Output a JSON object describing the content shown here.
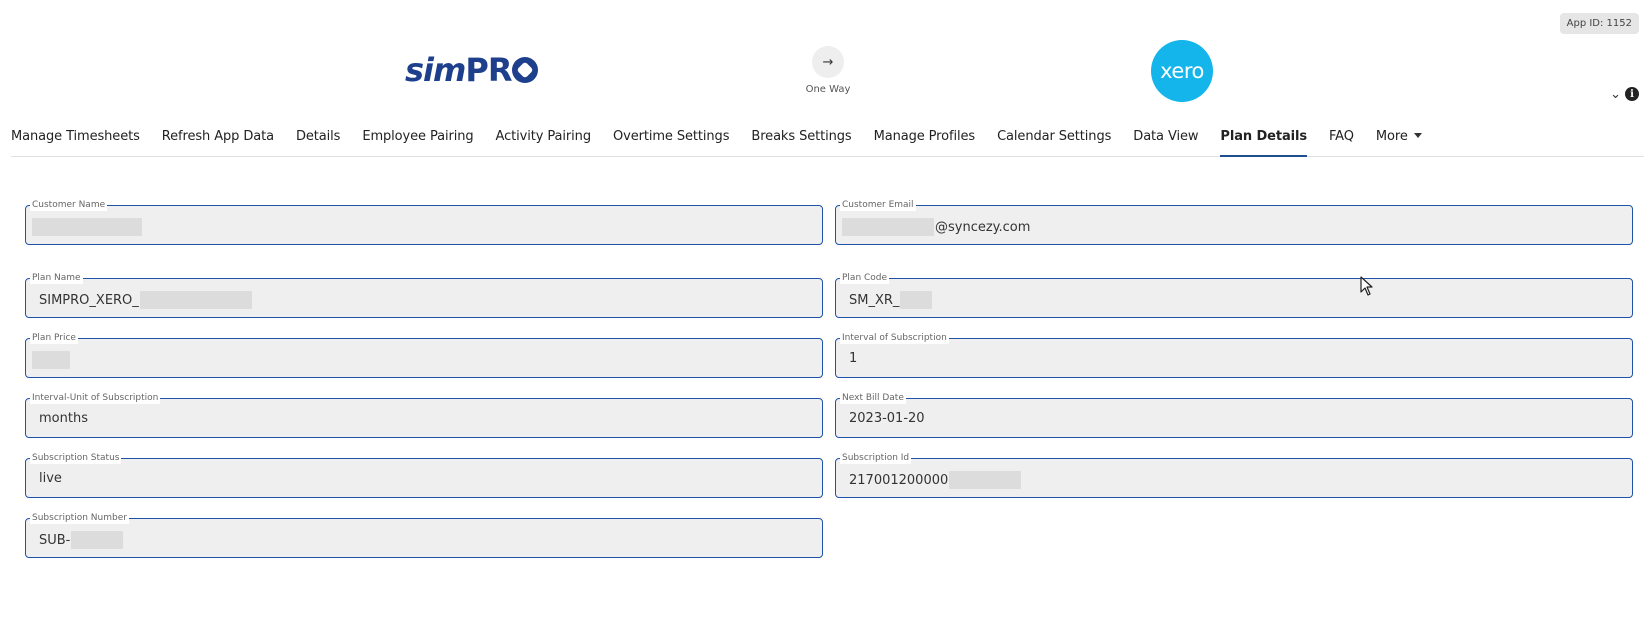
{
  "app_id": "App ID: 1152",
  "header": {
    "left_logo": {
      "part1": "sim",
      "part2": "PR"
    },
    "sync": {
      "icon": "arrow-right-icon",
      "glyph": "→",
      "label": "One Way"
    },
    "right_logo": "xero",
    "collapse_glyph": "⌄",
    "info_glyph": "i"
  },
  "nav": {
    "tabs": [
      {
        "label": "Manage Timesheets",
        "active": false
      },
      {
        "label": "Refresh App Data",
        "active": false
      },
      {
        "label": "Details",
        "active": false
      },
      {
        "label": "Employee Pairing",
        "active": false
      },
      {
        "label": "Activity Pairing",
        "active": false
      },
      {
        "label": "Overtime Settings",
        "active": false
      },
      {
        "label": "Breaks Settings",
        "active": false
      },
      {
        "label": "Manage Profiles",
        "active": false
      },
      {
        "label": "Calendar Settings",
        "active": false
      },
      {
        "label": "Data View",
        "active": false
      },
      {
        "label": "Plan Details",
        "active": true
      },
      {
        "label": "FAQ",
        "active": false
      },
      {
        "label": "More",
        "active": false
      }
    ]
  },
  "fields": {
    "customer_name": {
      "label": "Customer Name",
      "value": ""
    },
    "customer_email": {
      "label": "Customer Email",
      "value": "@syncezy.com"
    },
    "plan_name": {
      "label": "Plan Name",
      "value": "SIMPRO_XERO_"
    },
    "plan_code": {
      "label": "Plan Code",
      "value": "SM_XR_"
    },
    "plan_price": {
      "label": "Plan Price",
      "value": ""
    },
    "interval": {
      "label": "Interval of Subscription",
      "value": "1"
    },
    "interval_unit": {
      "label": "Interval-Unit of Subscription",
      "value": "months"
    },
    "next_bill_date": {
      "label": "Next Bill Date",
      "value": "2023-01-20"
    },
    "subscription_status": {
      "label": "Subscription Status",
      "value": "live"
    },
    "subscription_id": {
      "label": "Subscription Id",
      "value": "217001200000"
    },
    "subscription_number": {
      "label": "Subscription Number",
      "value": "SUB-"
    }
  },
  "colors": {
    "accent": "#1e53a8",
    "simpro_blue": "#1d3f8c",
    "xero_blue": "#13b5ea",
    "field_bg": "#efefef"
  }
}
